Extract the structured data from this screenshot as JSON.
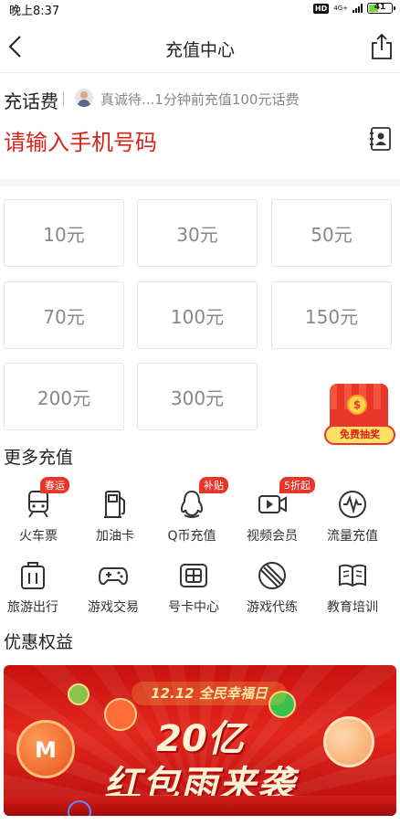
{
  "status_bar": {
    "time": "晚上8:37",
    "hd": "HD",
    "network": "4G+",
    "battery": "41",
    "battery_level": 0.41
  },
  "navbar": {
    "title": "充值中心"
  },
  "recharge": {
    "label": "充话费",
    "notice": "真诚待...1分钟前充值100元话费",
    "phone_placeholder": "请输入手机号码"
  },
  "amounts": [
    "10元",
    "30元",
    "50元",
    "70元",
    "100元",
    "150元",
    "200元",
    "300元"
  ],
  "lottery": {
    "label": "免费抽奖",
    "coin": "$"
  },
  "more": {
    "title": "更多充值",
    "items": [
      {
        "label": "火车票",
        "icon": "train-icon",
        "badge": "春运"
      },
      {
        "label": "加油卡",
        "icon": "fuel-pump-icon",
        "badge": ""
      },
      {
        "label": "Q币充值",
        "icon": "qq-penguin-icon",
        "badge": "补贴"
      },
      {
        "label": "视频会员",
        "icon": "video-camera-icon",
        "badge": "5折起"
      },
      {
        "label": "流量充值",
        "icon": "data-wave-icon",
        "badge": ""
      },
      {
        "label": "旅游出行",
        "icon": "luggage-icon",
        "badge": ""
      },
      {
        "label": "游戏交易",
        "icon": "gamepad-icon",
        "badge": ""
      },
      {
        "label": "号卡中心",
        "icon": "sim-card-icon",
        "badge": ""
      },
      {
        "label": "游戏代练",
        "icon": "game-coach-icon",
        "badge": ""
      },
      {
        "label": "教育培训",
        "icon": "open-book-icon",
        "badge": ""
      }
    ]
  },
  "benefits": {
    "title": "优惠权益",
    "banner": {
      "date": "12.12 全民幸福日",
      "headline": "20亿",
      "subline": "红包雨来袭"
    }
  },
  "colors": {
    "accent": "#d9231a",
    "badge": "#e8362a",
    "banner": "#e2261d"
  }
}
